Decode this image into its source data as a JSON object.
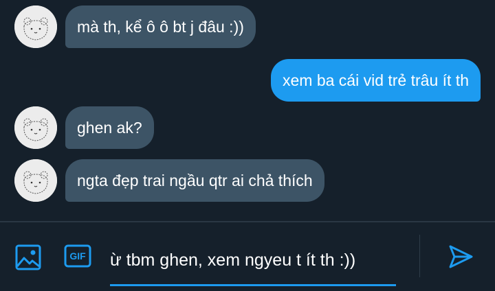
{
  "messages": [
    {
      "direction": "in",
      "text": "mà th, kể ô ô bt j đâu :))"
    },
    {
      "direction": "out",
      "text": "xem ba cái vid trẻ trâu ít th"
    },
    {
      "direction": "in",
      "text": "ghen ak?"
    },
    {
      "direction": "in",
      "text": "ngta đẹp trai ngầu qtr ai chả thích"
    }
  ],
  "composer": {
    "media_icon": "image-icon",
    "gif_label": "GIF",
    "input_value": "ừ tbm ghen, xem ngyeu t ít th :))",
    "send_icon": "send-icon"
  },
  "colors": {
    "background": "#15202b",
    "incoming_bubble": "#3d5466",
    "outgoing_bubble": "#1d9bf0",
    "accent": "#1d9bf0"
  }
}
